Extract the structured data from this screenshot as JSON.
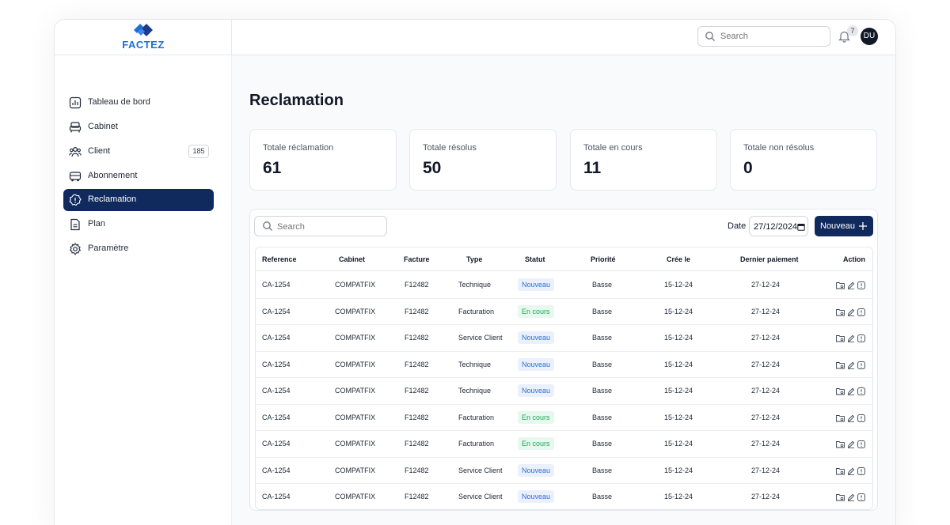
{
  "brand": {
    "name": "FACTEZ",
    "color": "#1d6fd6"
  },
  "header": {
    "search_placeholder": "Search",
    "notification_count": "7",
    "avatar_initials": "DU"
  },
  "sidebar": {
    "items": [
      {
        "label": "Tableau de bord",
        "icon": "bar-chart-icon"
      },
      {
        "label": "Cabinet",
        "icon": "couch-icon"
      },
      {
        "label": "Client",
        "icon": "users-icon",
        "count": "185"
      },
      {
        "label": "Abonnement",
        "icon": "bus-icon"
      },
      {
        "label": "Reclamation",
        "icon": "alert-badge-icon",
        "active": true
      },
      {
        "label": "Plan",
        "icon": "document-icon"
      },
      {
        "label": "Paramètre",
        "icon": "gear-icon"
      }
    ]
  },
  "main": {
    "title": "Reclamation",
    "stats": [
      {
        "label": "Totale réclamation",
        "value": "61"
      },
      {
        "label": "Totale résolus",
        "value": "50"
      },
      {
        "label": "Totale en cours",
        "value": "11"
      },
      {
        "label": "Totale non résolus",
        "value": "0"
      }
    ],
    "toolbar": {
      "search_placeholder": "Search",
      "date_label": "Date",
      "date_value": "27/12/2024",
      "new_button_label": "Nouveau"
    },
    "table": {
      "columns": [
        "Reference",
        "Cabinet",
        "Facture",
        "Type",
        "Statut",
        "Priorité",
        "Crée le",
        "Dernier paiement",
        "Action"
      ],
      "rows": [
        [
          "CA-1254",
          "COMPATFIX",
          "F12482",
          "Technique",
          "Nouveau",
          "Basse",
          "15-12-24",
          "27-12-24"
        ],
        [
          "CA-1254",
          "COMPATFIX",
          "F12482",
          "Facturation",
          "En cours",
          "Basse",
          "15-12-24",
          "27-12-24"
        ],
        [
          "CA-1254",
          "COMPATFIX",
          "F12482",
          "Service Client",
          "Nouveau",
          "Basse",
          "15-12-24",
          "27-12-24"
        ],
        [
          "CA-1254",
          "COMPATFIX",
          "F12482",
          "Technique",
          "Nouveau",
          "Basse",
          "15-12-24",
          "27-12-24"
        ],
        [
          "CA-1254",
          "COMPATFIX",
          "F12482",
          "Technique",
          "Nouveau",
          "Basse",
          "15-12-24",
          "27-12-24"
        ],
        [
          "CA-1254",
          "COMPATFIX",
          "F12482",
          "Facturation",
          "En cours",
          "Basse",
          "15-12-24",
          "27-12-24"
        ],
        [
          "CA-1254",
          "COMPATFIX",
          "F12482",
          "Facturation",
          "En cours",
          "Basse",
          "15-12-24",
          "27-12-24"
        ],
        [
          "CA-1254",
          "COMPATFIX",
          "F12482",
          "Service Client",
          "Nouveau",
          "Basse",
          "15-12-24",
          "27-12-24"
        ],
        [
          "CA-1254",
          "COMPATFIX",
          "F12482",
          "Service Client",
          "Nouveau",
          "Basse",
          "15-12-24",
          "27-12-24"
        ]
      ],
      "row_action_icons": [
        "folder-icon",
        "edit-icon",
        "info-icon"
      ]
    }
  },
  "colors": {
    "primary": "#102a5e",
    "status_nouveau": "#2f6fd8",
    "status_en_cours": "#22a55a"
  }
}
